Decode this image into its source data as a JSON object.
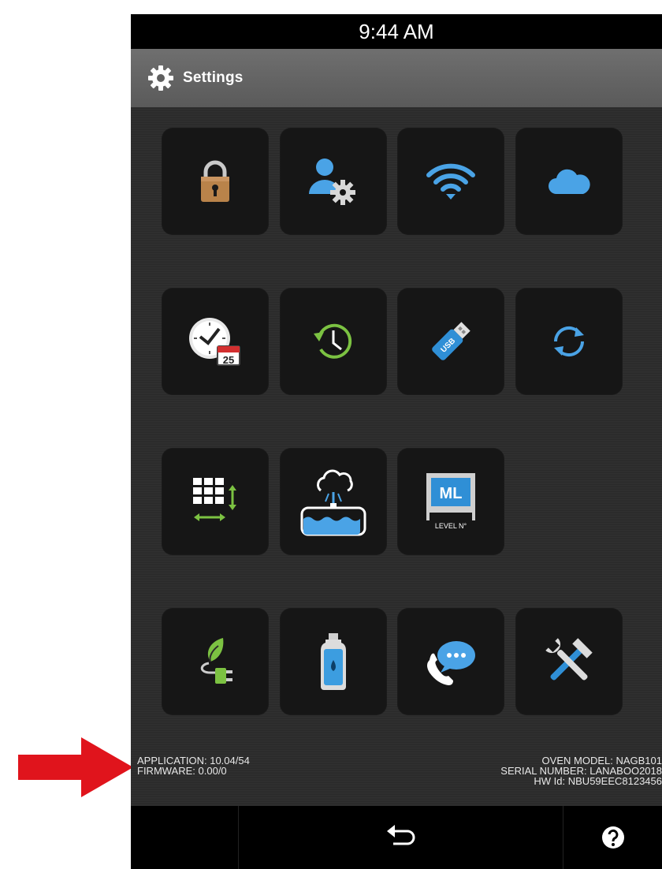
{
  "status": {
    "time": "9:44 AM"
  },
  "header": {
    "title": "Settings",
    "icon": "gear-icon"
  },
  "tiles": [
    {
      "icon": "lock-icon"
    },
    {
      "icon": "user-settings-icon"
    },
    {
      "icon": "wifi-icon"
    },
    {
      "icon": "cloud-icon"
    },
    {
      "icon": "clock-calendar-icon",
      "calendar_day": "25"
    },
    {
      "icon": "history-icon"
    },
    {
      "icon": "usb-icon",
      "usb_label": "USB"
    },
    {
      "icon": "sync-icon"
    },
    {
      "icon": "grid-resize-icon"
    },
    {
      "icon": "water-tank-icon"
    },
    {
      "icon": "ml-level-icon",
      "ml_label": "ML",
      "level_label": "LEVEL N°"
    },
    {
      "icon": "eco-plug-icon"
    },
    {
      "icon": "water-bottle-icon"
    },
    {
      "icon": "phone-chat-icon"
    },
    {
      "icon": "tools-icon"
    }
  ],
  "info_left": {
    "application": "APPLICATION: 10.04/54",
    "firmware": "FIRMWARE: 0.00/0"
  },
  "info_right": {
    "oven_model": "OVEN MODEL: NAGB101",
    "serial_number": "SERIAL NUMBER: LANABOO2018",
    "hw_id": "HW Id: NBU59EEC8123456"
  },
  "nav": {
    "back_icon": "back-icon",
    "help_icon": "help-icon"
  },
  "colors": {
    "annotation_arrow": "#e0141c",
    "accent_blue": "#4aa3e6",
    "accent_green": "#7cc242"
  }
}
